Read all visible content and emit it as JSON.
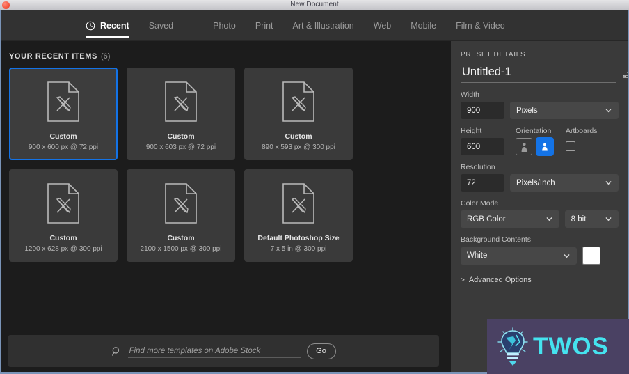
{
  "window": {
    "title": "New Document",
    "close_icon": "close-button-red"
  },
  "tabs": [
    {
      "label": "Recent",
      "icon": "clock-icon",
      "active": true
    },
    {
      "label": "Saved",
      "active": false
    },
    {
      "label": "Photo",
      "active": false
    },
    {
      "label": "Print",
      "active": false
    },
    {
      "label": "Art & Illustration",
      "active": false
    },
    {
      "label": "Web",
      "active": false
    },
    {
      "label": "Mobile",
      "active": false
    },
    {
      "label": "Film & Video",
      "active": false
    }
  ],
  "recent": {
    "heading": "YOUR RECENT ITEMS",
    "count": "(6)",
    "items": [
      {
        "title": "Custom",
        "spec": "900 x 600 px @ 72 ppi",
        "selected": true
      },
      {
        "title": "Custom",
        "spec": "900 x 603 px @ 72 ppi",
        "selected": false
      },
      {
        "title": "Custom",
        "spec": "890 x 593 px @ 300 ppi",
        "selected": false
      },
      {
        "title": "Custom",
        "spec": "1200 x 628 px @ 300 ppi",
        "selected": false
      },
      {
        "title": "Custom",
        "spec": "2100 x 1500 px @ 300 ppi",
        "selected": false
      },
      {
        "title": "Default Photoshop Size",
        "spec": "7 x 5 in @ 300 ppi",
        "selected": false
      }
    ]
  },
  "search": {
    "placeholder": "Find more templates on Adobe Stock",
    "value": "",
    "go_label": "Go",
    "icon": "search-icon"
  },
  "preset": {
    "heading": "PRESET DETAILS",
    "name": "Untitled-1",
    "save_icon": "save-preset-icon",
    "width": {
      "label": "Width",
      "value": "900",
      "unit": "Pixels"
    },
    "height": {
      "label": "Height",
      "value": "600"
    },
    "orientation": {
      "label": "Orientation",
      "portrait_icon": "portrait-orientation-icon",
      "landscape_icon": "landscape-orientation-icon",
      "selected": "landscape"
    },
    "artboards": {
      "label": "Artboards",
      "checked": false
    },
    "resolution": {
      "label": "Resolution",
      "value": "72",
      "unit": "Pixels/Inch"
    },
    "color_mode": {
      "label": "Color Mode",
      "value": "RGB Color",
      "depth": "8 bit"
    },
    "background": {
      "label": "Background Contents",
      "value": "White",
      "swatch": "#ffffff"
    },
    "advanced": {
      "label": "Advanced Options",
      "caret": ">"
    }
  },
  "watermark": {
    "text": "TWOS",
    "icon": "lightbulb-icon",
    "accent": "#45e3ef",
    "background": "#4a4163"
  },
  "colors": {
    "accent_blue": "#1473e6",
    "panel_bg": "#3a3a3a",
    "content_bg": "#1c1c1c",
    "tabbar_bg": "#323232",
    "card_bg": "#3a3a3a"
  }
}
